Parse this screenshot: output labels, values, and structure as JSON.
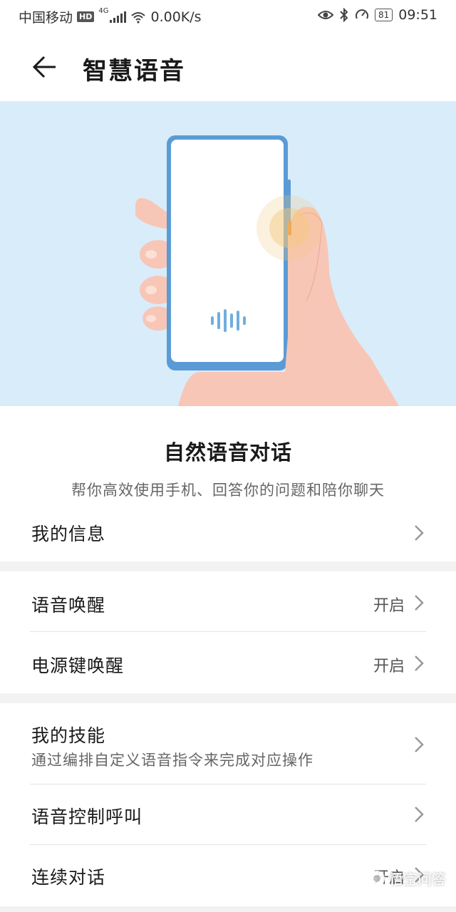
{
  "status_bar": {
    "carrier": "中国移动",
    "hd_badge": "HD",
    "network": "4G",
    "speed": "0.00K/s",
    "battery": "81",
    "time": "09:51"
  },
  "header": {
    "title": "智慧语音"
  },
  "intro": {
    "title": "自然语音对话",
    "subtitle": "帮你高效使用手机、回答你的问题和陪你聊天"
  },
  "rows": {
    "my_info": {
      "label": "我的信息"
    },
    "voice_wakeup": {
      "label": "语音唤醒",
      "value": "开启"
    },
    "power_key_wakeup": {
      "label": "电源键唤醒",
      "value": "开启"
    },
    "my_skills": {
      "label": "我的技能",
      "desc": "通过编排自定义语音指令来完成对应操作"
    },
    "voice_call": {
      "label": "语音控制呼叫"
    },
    "continuous_dialog": {
      "label": "连续对话",
      "value": "开启"
    }
  },
  "watermark": {
    "text": "悟空问答"
  },
  "colors": {
    "banner_bg": "#d9ecfa",
    "phone_frame": "#5b9bd5",
    "hand": "#f8c6b6",
    "glow": "#f5c77e"
  }
}
